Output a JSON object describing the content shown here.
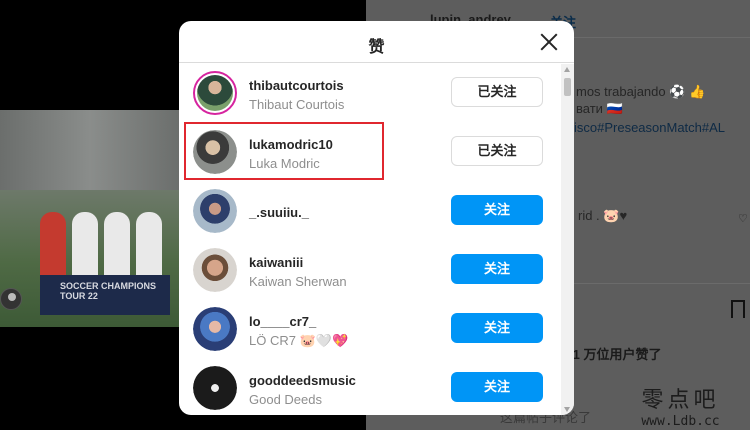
{
  "modal": {
    "title": "赞",
    "users": [
      {
        "username": "thibautcourtois",
        "full_name": "Thibaut Courtois",
        "button": "已关注",
        "state": "following",
        "has_story": true
      },
      {
        "username": "lukamodric10",
        "full_name": "Luka Modric",
        "button": "已关注",
        "state": "following",
        "highlighted": true
      },
      {
        "username": "_.suuiiu._",
        "full_name": "",
        "button": "关注",
        "state": "follow"
      },
      {
        "username": "kaiwaniii",
        "full_name": "Kaiwan Sherwan",
        "button": "关注",
        "state": "follow"
      },
      {
        "username": "lo____cr7_",
        "full_name": "LÖ CR7 🐷🤍💖",
        "button": "关注",
        "state": "follow"
      },
      {
        "username": "gooddeedsmusic",
        "full_name": "Good Deeds",
        "button": "关注",
        "state": "follow"
      }
    ]
  },
  "background": {
    "author": "lupin_andrey",
    "follow": "· 关注",
    "caption_line1": "mos trabajando ⚽ 👍",
    "caption_line2": "вати 🇷🇺",
    "hashtags": "isco#PreseasonMatch#AL",
    "comment_snippet": "rid . 🐷♥",
    "likes": ".1 万位用户赞了",
    "comments_link": "这篇帖子评论了",
    "banner_text": "SOCCER CHAMPIONS TOUR 22"
  },
  "watermark": {
    "main": "零点吧",
    "site": "www.Ldb.cc"
  },
  "colors": {
    "follow_blue": "#0095f6",
    "highlight_red": "#e0272f",
    "story_ring": "#d6249f"
  }
}
